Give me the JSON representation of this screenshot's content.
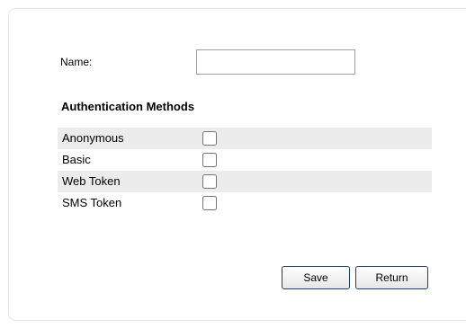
{
  "form": {
    "name_label": "Name:",
    "name_value": "",
    "section_title": "Authentication Methods"
  },
  "methods": [
    {
      "label": "Anonymous",
      "checked": false
    },
    {
      "label": "Basic",
      "checked": false
    },
    {
      "label": "Web Token",
      "checked": false
    },
    {
      "label": "SMS Token",
      "checked": false
    }
  ],
  "buttons": {
    "save_label": "Save",
    "return_label": "Return"
  },
  "colors": {
    "row_shade": "#ececec",
    "checkbox_border": "#365c85",
    "button_border": "#1e3f6b"
  }
}
